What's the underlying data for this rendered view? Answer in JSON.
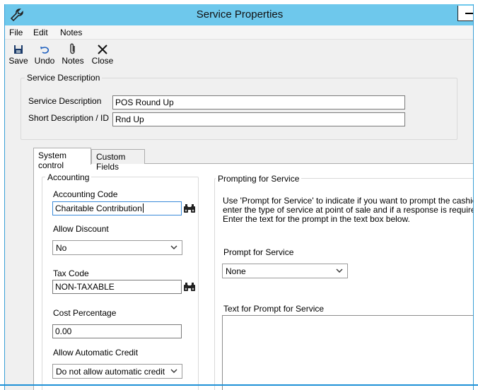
{
  "window": {
    "title": "Service Properties"
  },
  "menu": [
    "File",
    "Edit",
    "Notes"
  ],
  "toolbar": {
    "save": "Save",
    "undo": "Undo",
    "notes": "Notes",
    "close": "Close"
  },
  "service_description": {
    "group_label": "Service Description",
    "desc_label": "Service Description",
    "desc_value": "POS Round Up",
    "short_label": "Short Description / ID",
    "short_value": "Rnd Up"
  },
  "tabs": {
    "system_control": "System control",
    "custom_fields": "Custom Fields",
    "active": "System control"
  },
  "accounting": {
    "group_label": "Accounting",
    "accounting_code_label": "Accounting Code",
    "accounting_code_value": "Charitable Contribution",
    "allow_discount_label": "Allow Discount",
    "allow_discount_value": "No",
    "tax_code_label": "Tax Code",
    "tax_code_value": "NON-TAXABLE",
    "cost_percentage_label": "Cost Percentage",
    "cost_percentage_value": "0.00",
    "allow_auto_credit_label": "Allow Automatic Credit",
    "allow_auto_credit_value": "Do not allow automatic credit"
  },
  "prompting": {
    "group_label": "Prompting for Service",
    "help_text_1": "Use 'Prompt for Service' to indicate if you want to prompt the cashier to",
    "help_text_2": "enter the type of service at point of sale and if a response is required.",
    "help_text_3": "Enter the text for the prompt in the text box below.",
    "prompt_label": "Prompt for Service",
    "prompt_value": "None",
    "text_prompt_label": "Text for Prompt for Service",
    "text_prompt_value": ""
  },
  "colors": {
    "titlebar": "#6ec8ec",
    "window_bg": "#f0f0f0",
    "focus_border": "#3a8ad8"
  },
  "icons": {
    "app": "wrench-icon",
    "save": "floppy-disk-icon",
    "undo": "undo-arrow-icon",
    "notes": "paperclip-icon",
    "close": "close-x-icon",
    "lookup": "binoculars-icon"
  }
}
